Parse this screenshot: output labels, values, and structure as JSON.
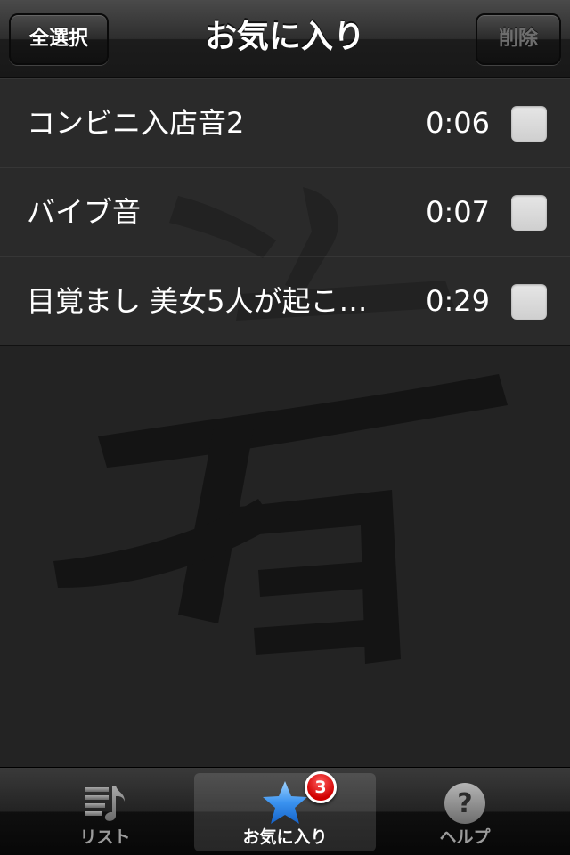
{
  "navbar": {
    "title": "お気に入り",
    "select_all_label": "全選択",
    "delete_label": "削除"
  },
  "favorites": [
    {
      "title": "コンビニ入店音2",
      "duration": "0:06",
      "checked": false
    },
    {
      "title": "バイブ音",
      "duration": "0:07",
      "checked": false
    },
    {
      "title": "目覚まし 美女5人が起こ…",
      "duration": "0:29",
      "checked": false
    }
  ],
  "tabbar": {
    "tabs": [
      {
        "label": "リスト",
        "icon": "music-list-icon",
        "selected": false
      },
      {
        "label": "お気に入り",
        "icon": "star-icon",
        "selected": true,
        "badge": "3"
      },
      {
        "label": "ヘルプ",
        "icon": "help-icon",
        "selected": false
      }
    ]
  },
  "colors": {
    "background": "#232323",
    "star": "#2f86e6",
    "badge": "#d00000",
    "text": "#ffffff"
  }
}
